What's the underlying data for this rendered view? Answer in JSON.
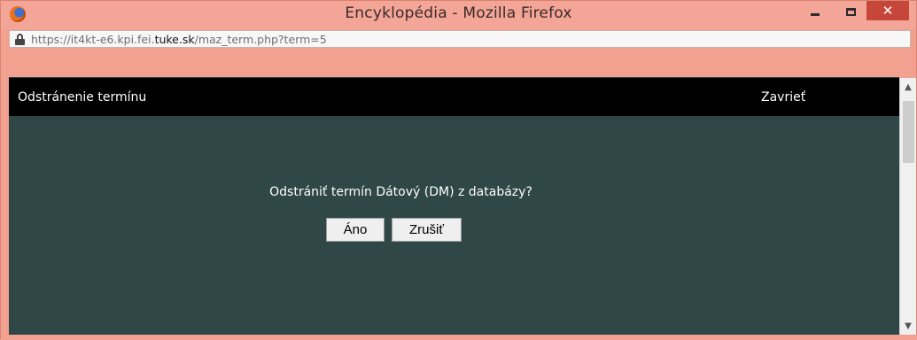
{
  "window": {
    "title": "Encyklopédia - Mozilla Firefox",
    "minimize_label": "",
    "close_label": "✕"
  },
  "urlbar": {
    "url_prefix": "https://it4kt-e6.kpi.fei.",
    "url_host": "tuke.sk",
    "url_path": "/maz_term.php?term=5"
  },
  "dialog": {
    "title": "Odstránenie termínu",
    "close_label": "Zavrieť",
    "question": "Odstrániť termín Dátový (DM) z databázy?",
    "yes_label": "Áno",
    "cancel_label": "Zrušiť"
  },
  "colors": {
    "titlebar": "#f3a597",
    "close_button": "#c7463a",
    "header": "#000000",
    "content": "#2f4747"
  }
}
